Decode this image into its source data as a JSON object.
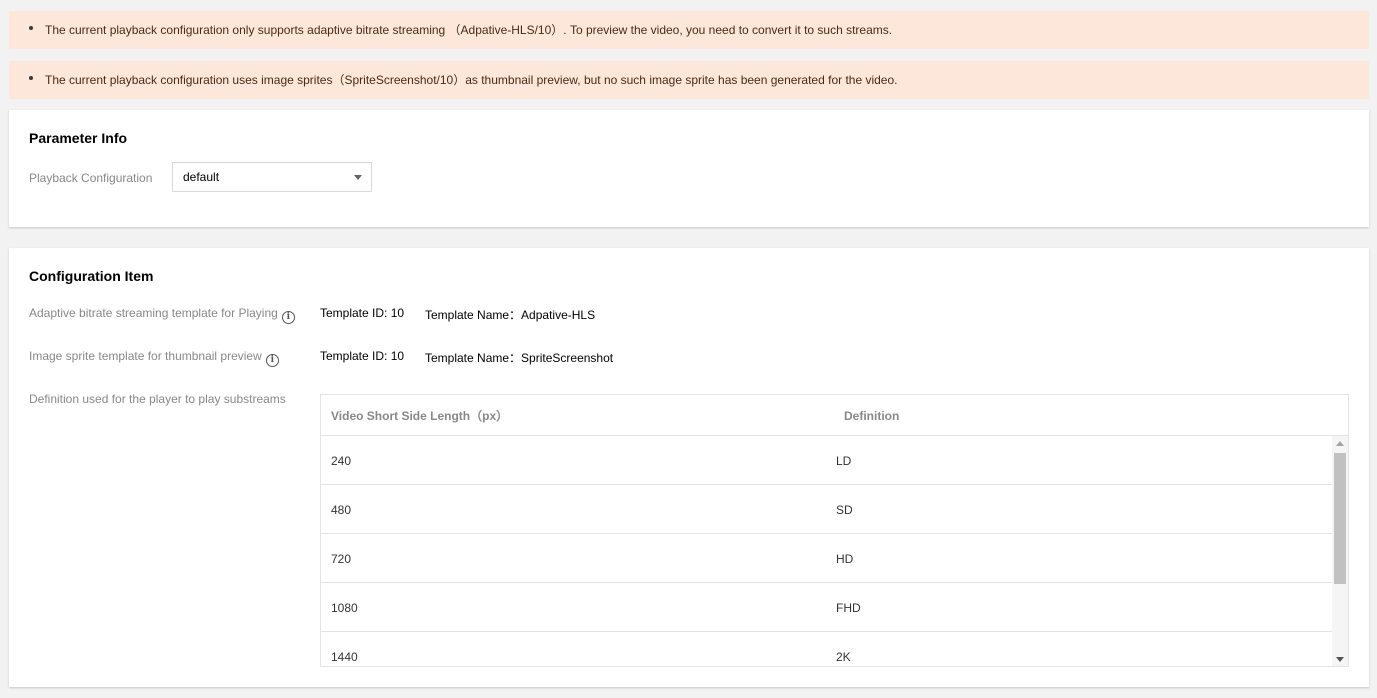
{
  "alerts": [
    {
      "text": "The current playback configuration only supports adaptive bitrate streaming （Adpative-HLS/10）. To preview the video, you need to convert it to such streams."
    },
    {
      "text": "The current playback configuration uses image sprites（SpriteScreenshot/10）as thumbnail preview, but no such image sprite has been generated for the video."
    }
  ],
  "parameter_info": {
    "title": "Parameter Info",
    "playback_label": "Playback Configuration",
    "playback_value": "default"
  },
  "configuration_item": {
    "title": "Configuration Item",
    "adaptive": {
      "label": "Adaptive bitrate streaming template for Playing",
      "template_id": "Template ID: 10",
      "template_name_label": "Template Name：",
      "template_name": "Adpative-HLS"
    },
    "sprite": {
      "label": "Image sprite template for thumbnail preview",
      "template_id": "Template ID: 10",
      "template_name_label": "Template Name：",
      "template_name": "SpriteScreenshot"
    },
    "definition_label": "Definition used for the player to play substreams",
    "table": {
      "headers": [
        "Video Short Side Length（px）",
        "Definition"
      ],
      "rows": [
        {
          "length": "240",
          "definition": "LD"
        },
        {
          "length": "480",
          "definition": "SD"
        },
        {
          "length": "720",
          "definition": "HD"
        },
        {
          "length": "1080",
          "definition": "FHD"
        },
        {
          "length": "1440",
          "definition": "2K"
        }
      ]
    }
  },
  "colors": {
    "alert_bg": "#fde7da",
    "alert_text": "#4a2a14",
    "page_bg": "#f2f2f2",
    "label_gray": "#888888"
  },
  "icons": {
    "info": "info-circle-icon",
    "select_caret": "caret-down-icon"
  }
}
